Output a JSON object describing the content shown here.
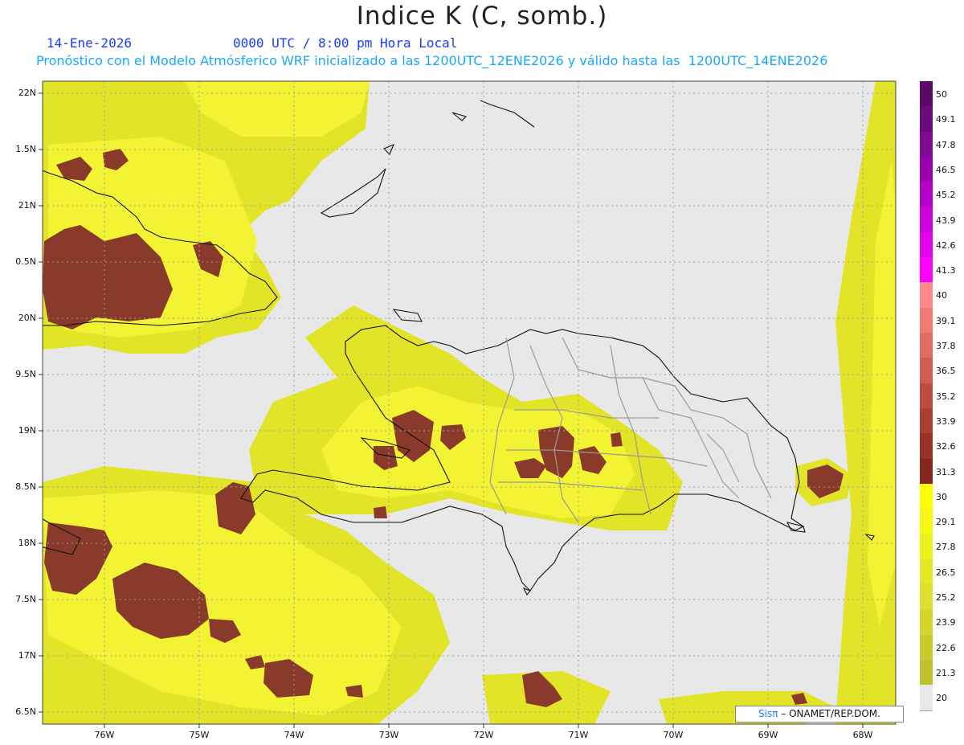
{
  "title": "Indice K (C, somb.)",
  "header": {
    "date": "14-Ene-2026",
    "time": "0000 UTC / 8:00 pm Hora Local",
    "forecast": "Pronóstico con el Modelo Atmósferico WRF inicializado a las 1200UTC_12ENE2026 y válido hasta las  1200UTC_14ENE2026"
  },
  "axes": {
    "lat_labels": [
      "22N",
      "1.5N",
      "21N",
      "0.5N",
      "20N",
      "9.5N",
      "19N",
      "8.5N",
      "18N",
      "7.5N",
      "17N",
      "6.5N"
    ],
    "lon_labels": [
      "76W",
      "75W",
      "74W",
      "73W",
      "72W",
      "71W",
      "70W",
      "69W",
      "68W"
    ]
  },
  "colorbar": {
    "values": [
      "50",
      "49.1",
      "47.8",
      "46.5",
      "45.2",
      "43.9",
      "42.6",
      "41.3",
      "40",
      "39.1",
      "37.8",
      "36.5",
      "35.2",
      "33.9",
      "32.6",
      "31.3",
      "30",
      "29.1",
      "27.8",
      "26.5",
      "25.2",
      "23.9",
      "22.6",
      "21.3",
      "20"
    ],
    "colors": [
      "#5a0a66",
      "#6b0a7a",
      "#800a94",
      "#9a00b0",
      "#b400c8",
      "#cc00dc",
      "#e400ee",
      "#ff00ff",
      "#ff8888",
      "#f07a74",
      "#e06c62",
      "#d05c52",
      "#bf4c42",
      "#ac3e32",
      "#983226",
      "#85281c",
      "#fbff00",
      "#f4f810",
      "#ecf01c",
      "#e4e826",
      "#dcdf2c",
      "#d2d62e",
      "#c8cb30",
      "#bec12e",
      "#e8e8e8"
    ]
  },
  "credit": {
    "logo": "Sisπ",
    "text": "– ONAMET/REP.DOM."
  },
  "colors": {
    "background": "#e8e8e8",
    "low_k": "#d6d930",
    "mid_k": "#f3f432",
    "high_k": "#8a3a2a"
  }
}
